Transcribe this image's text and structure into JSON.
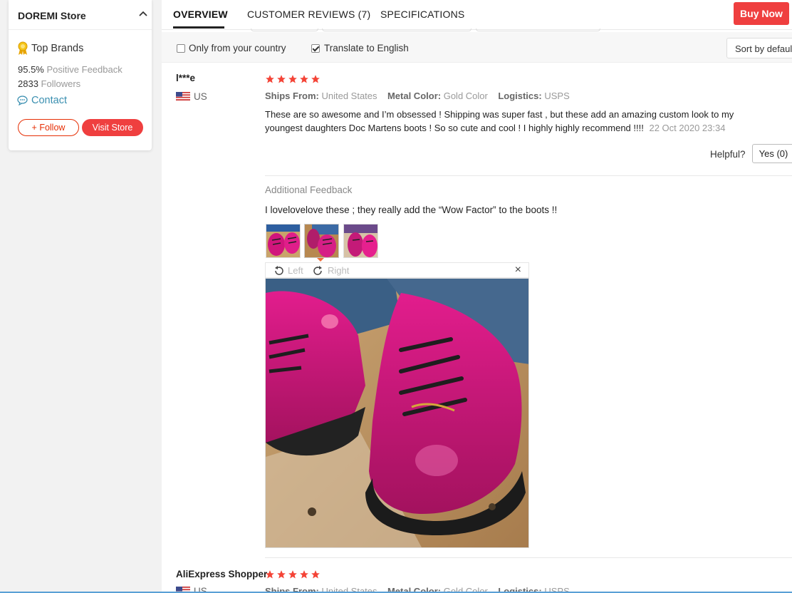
{
  "store": {
    "name": "DOREMI Store",
    "badge_label": "Top Brands",
    "feedback_value": "95.5%",
    "feedback_label": "Positive Feedback",
    "followers_value": "2833",
    "followers_label": "Followers",
    "contact_label": "Contact",
    "follow_label": "+ Follow",
    "visit_label": "Visit Store"
  },
  "tabs": [
    {
      "label": "OVERVIEW",
      "active": true
    },
    {
      "label": "CUSTOMER REVIEWS (7)",
      "active": false
    },
    {
      "label": "SPECIFICATIONS",
      "active": false
    }
  ],
  "buy_now_label": "Buy Now",
  "filters": {
    "only_country_label": "Only from your country",
    "only_country_checked": false,
    "translate_label": "Translate to English",
    "translate_checked": true,
    "sort_label": "Sort by default"
  },
  "reviews": [
    {
      "user": "l***e",
      "country": "US",
      "stars": 5,
      "ships_from_label": "Ships From:",
      "ships_from": "United States",
      "metal_label": "Metal Color:",
      "metal": "Gold Color",
      "logistics_label": "Logistics:",
      "logistics": "USPS",
      "text": "These are so awesome and I’m obsessed ! Shipping was super fast , but these add an amazing custom look to my youngest daughters Doc Martens boots ! So so cute and cool ! I highly highly recommend !!!!",
      "date": "22 Oct 2020 23:34",
      "helpful_label": "Helpful?",
      "yes_label": "Yes (0)",
      "additional_label": "Additional Feedback",
      "additional_text": "I lovelovelove these ; they really add the “Wow Factor” to the boots !!",
      "viewer": {
        "left_label": "Left",
        "right_label": "Right",
        "close_icon": "×"
      }
    },
    {
      "user": "AliExpress Shopper",
      "country": "US",
      "stars": 5,
      "ships_from_label": "Ships From:",
      "ships_from": "United States",
      "metal_label": "Metal Color:",
      "metal": "Gold Color",
      "logistics_label": "Logistics:",
      "logistics": "USPS"
    }
  ],
  "colors": {
    "accent": "#ef3f3f",
    "star": "#f44336",
    "link": "#3a8fb0"
  }
}
